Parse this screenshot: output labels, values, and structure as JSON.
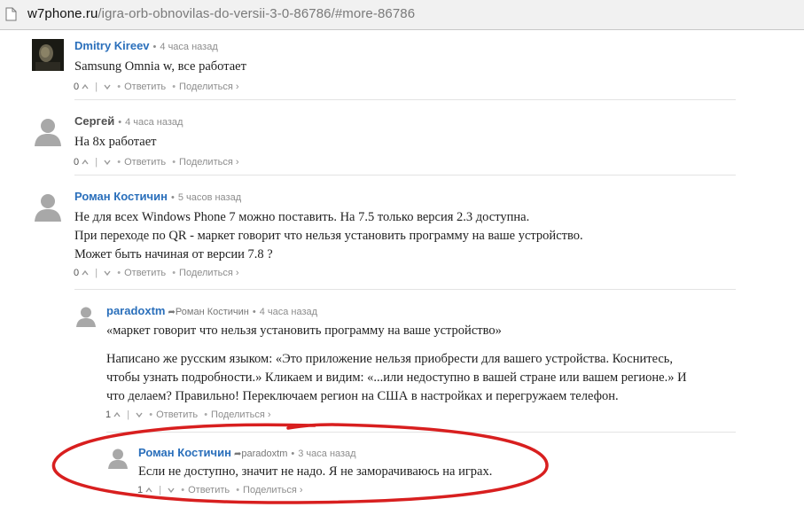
{
  "browser": {
    "url_host": "w7phone.ru",
    "url_path": "/igra-orb-obnovilas-do-versii-3-0-86786/#more-86786"
  },
  "comments": [
    {
      "author": "Dmitry Kireev",
      "time": "4 часа назад",
      "lines": [
        "Samsung Omnia w, все работает"
      ],
      "votes": "0",
      "reply_label": "Ответить",
      "share_label": "Поделиться ›"
    },
    {
      "author": "Сергей",
      "time": "4 часа назад",
      "lines": [
        "На 8x работает"
      ],
      "votes": "0",
      "reply_label": "Ответить",
      "share_label": "Поделиться ›"
    },
    {
      "author": "Роман Костичин",
      "time": "5 часов назад",
      "lines": [
        "Не для всех Windows Phone 7 можно поставить. На 7.5 только версия 2.3 доступна.",
        "При переходе по QR - маркет говорит что нельзя установить программу на ваше устройство.",
        "Может быть начиная от версии 7.8 ?"
      ],
      "votes": "0",
      "reply_label": "Ответить",
      "share_label": "Поделиться ›"
    },
    {
      "author": "paradoxtm",
      "reply_to": "Роман Костичин",
      "time": "4 часа назад",
      "lines": [
        "«маркет говорит что нельзя установить программу на ваше устройство»",
        "",
        "Написано же русским языком: «Это приложение нельзя приобрести для вашего устройства. Коснитесь,",
        "чтобы узнать подробности.» Кликаем и видим: «...или недоступно в вашей стране или вашем регионе.» И",
        "что делаем? Правильно! Переключаем регион на США в настройках и перегружаем телефон."
      ],
      "votes": "1",
      "reply_label": "Ответить",
      "share_label": "Поделиться ›"
    },
    {
      "author": "Роман Костичин",
      "reply_to": "paradoxtm",
      "time": "3 часа назад",
      "lines": [
        "Если не доступно, значит не надо. Я не заморачиваюсь на играх."
      ],
      "votes": "1",
      "reply_label": "Ответить",
      "share_label": "Поделиться ›"
    }
  ],
  "colors": {
    "author_link": "#2a6fbb",
    "annotation_ellipse": "#d81f1f"
  },
  "icons": {
    "upvote": "chevron-up-icon",
    "downvote": "chevron-down-icon",
    "avatar_placeholder": "user-silhouette-icon",
    "reply_arrow": "reply-arrow-icon"
  }
}
